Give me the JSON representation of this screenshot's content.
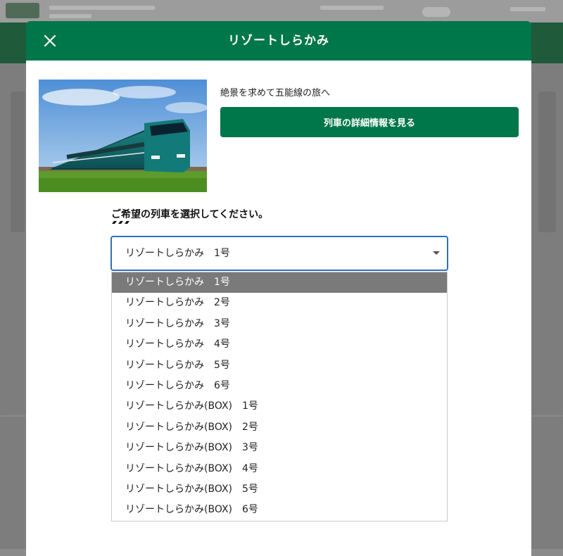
{
  "modal": {
    "title": "リゾートしらかみ",
    "catchphrase": "絶景を求めて五能線の旅へ",
    "detail_button_label": "列車の詳細情報を見る",
    "select_heading": "ご希望の列車を選択してください。",
    "icons": {
      "close": "close-icon",
      "caret": "chevron-down-icon"
    },
    "accent_color": "#00764b"
  },
  "train_select": {
    "value": "リゾートしらかみ　1号",
    "options": [
      "リゾートしらかみ　1号",
      "リゾートしらかみ　2号",
      "リゾートしらかみ　3号",
      "リゾートしらかみ　4号",
      "リゾートしらかみ　5号",
      "リゾートしらかみ　6号",
      "リゾートしらかみ(BOX)　1号",
      "リゾートしらかみ(BOX)　2号",
      "リゾートしらかみ(BOX)　3号",
      "リゾートしらかみ(BOX)　4号",
      "リゾートしらかみ(BOX)　5号",
      "リゾートしらかみ(BOX)　6号"
    ],
    "selected_index": 0
  }
}
